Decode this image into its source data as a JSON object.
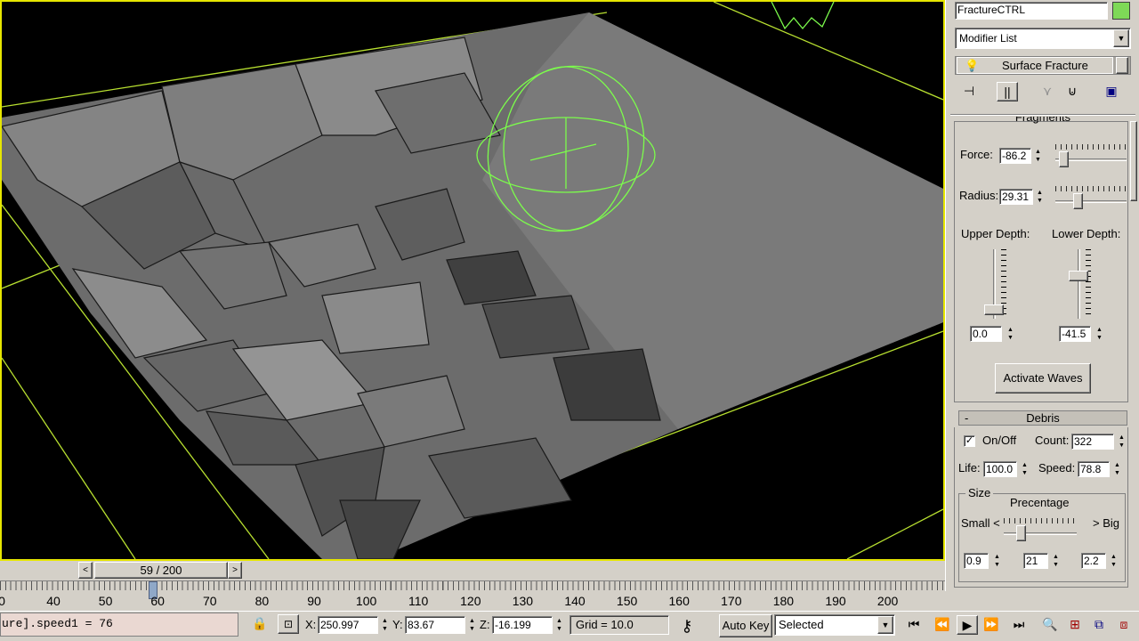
{
  "command_panel": {
    "object_name": "FractureCTRL",
    "object_color": "#7ed957",
    "modifier_list_label": "Modifier List",
    "modifier_stack_item": "Surface Fracture"
  },
  "fragments_rollout": {
    "title": "Fragments",
    "force_label": "Force:",
    "force_value": "-86.2",
    "radius_label": "Radius:",
    "radius_value": "29.31",
    "upper_depth_label": "Upper Depth:",
    "lower_depth_label": "Lower Depth:",
    "upper_depth_value": "0.0",
    "lower_depth_value": "-41.5",
    "activate_waves_label": "Activate Waves"
  },
  "debris_rollout": {
    "collapse_symbol": "-",
    "title": "Debris",
    "onoff_checked": true,
    "onoff_label": "On/Off",
    "count_label": "Count:",
    "count_value": "322",
    "life_label": "Life:",
    "life_value": "100.0",
    "speed_label": "Speed:",
    "speed_value": "78.8",
    "size_group_label": "Size",
    "precentage_label": "Precentage",
    "small_label": "Small <",
    "big_label": "> Big",
    "small_value": "0.9",
    "mid_value": "21",
    "big_value": "2.2"
  },
  "timeline": {
    "frame_display": "59 / 200",
    "current_frame": 59,
    "total_frames": 200,
    "ruler_labels": [
      "0",
      "40",
      "50",
      "60",
      "70",
      "80",
      "90",
      "100",
      "110",
      "120",
      "130",
      "140",
      "150",
      "160",
      "170",
      "180",
      "190",
      "200"
    ]
  },
  "status": {
    "maxscript_output": "ure].speed1 = 76",
    "x_label": "X:",
    "x_value": "250.997",
    "y_label": "Y:",
    "y_value": "83.67",
    "z_label": "Z:",
    "z_value": "-16.199",
    "grid_label": "Grid = 10.0",
    "autokey_label": "Auto Key",
    "selection_dropdown": "Selected"
  },
  "colors": {
    "viewport_border": "#e6e600",
    "gizmo": "#7cfc4c",
    "grid_lines": "#b8e030",
    "surface": "#6e6e6e"
  },
  "icons": {
    "pin": "pin-stack-icon",
    "show_end": "show-end-result-icon",
    "make_unique": "make-unique-icon",
    "remove_mod": "remove-modifier-icon",
    "configure": "configure-sets-icon"
  }
}
